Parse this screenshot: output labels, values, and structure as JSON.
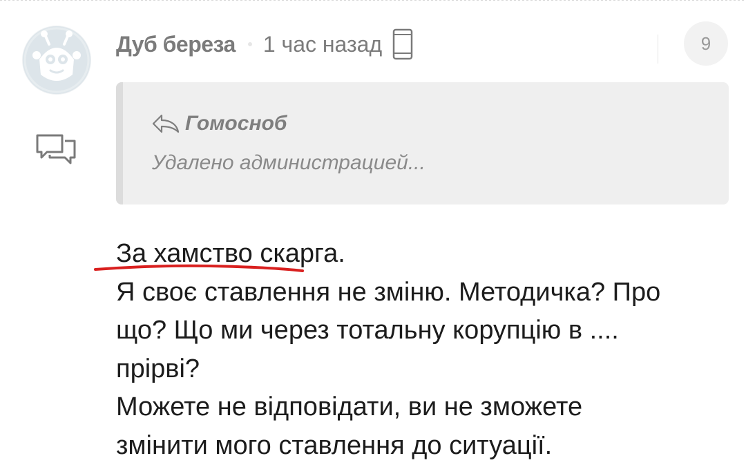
{
  "comment": {
    "author": "Дуб береза",
    "time": "1 час назад",
    "rating": "9",
    "icons": {
      "avatar": "alien-avatar",
      "device": "mobile-phone-icon",
      "reply": "speech-bubbles-icon",
      "quote_reply": "reply-arrow-icon"
    },
    "quote": {
      "author": "Гомосноб",
      "text": "Удалено администрацией..."
    },
    "body_lines": [
      "За хамство скарга.",
      "Я своє ставлення не зміню. Методичка? Про",
      "що? Що ми через тотальну корупцію в ....",
      "прірві?",
      "Можете не відповідати, ви не зможете",
      "змінити мого ставлення до ситуації."
    ],
    "highlight_color": "#d9201f"
  }
}
